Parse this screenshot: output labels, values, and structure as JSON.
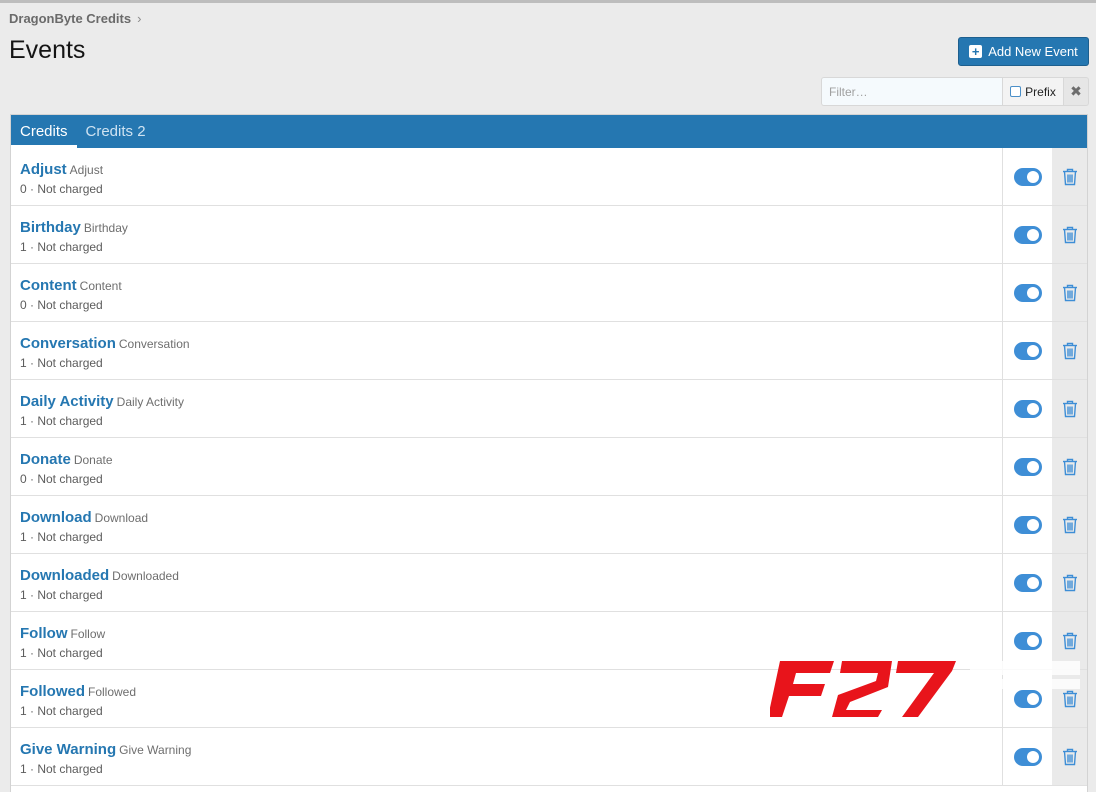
{
  "breadcrumb": {
    "item": "DragonByte Credits",
    "separator": "›"
  },
  "page_title": "Events",
  "add_button": {
    "label": "Add New Event",
    "icon": "plus-square-icon"
  },
  "filter": {
    "placeholder": "Filter…",
    "prefix_label": "Prefix",
    "clear_icon": "✖"
  },
  "tabs": [
    {
      "label": "Credits",
      "active": true
    },
    {
      "label": "Credits 2",
      "active": false
    }
  ],
  "events": [
    {
      "title": "Adjust",
      "subtitle": "Adjust",
      "meta": "0 · Not charged",
      "enabled": true
    },
    {
      "title": "Birthday",
      "subtitle": "Birthday",
      "meta": "1 · Not charged",
      "enabled": true
    },
    {
      "title": "Content",
      "subtitle": "Content",
      "meta": "0 · Not charged",
      "enabled": true
    },
    {
      "title": "Conversation",
      "subtitle": "Conversation",
      "meta": "1 · Not charged",
      "enabled": true
    },
    {
      "title": "Daily Activity",
      "subtitle": "Daily Activity",
      "meta": "1 · Not charged",
      "enabled": true
    },
    {
      "title": "Donate",
      "subtitle": "Donate",
      "meta": "0 · Not charged",
      "enabled": true
    },
    {
      "title": "Download",
      "subtitle": "Download",
      "meta": "1 · Not charged",
      "enabled": true
    },
    {
      "title": "Downloaded",
      "subtitle": "Downloaded",
      "meta": "1 · Not charged",
      "enabled": true
    },
    {
      "title": "Follow",
      "subtitle": "Follow",
      "meta": "1 · Not charged",
      "enabled": true
    },
    {
      "title": "Followed",
      "subtitle": "Followed",
      "meta": "1 · Not charged",
      "enabled": true
    },
    {
      "title": "Give Warning",
      "subtitle": "Give Warning",
      "meta": "1 · Not charged",
      "enabled": true
    }
  ],
  "watermark": {
    "text": "F27"
  },
  "colors": {
    "accent": "#2577b1",
    "toggle": "#3e8ed6",
    "watermark": "#e8141b"
  }
}
